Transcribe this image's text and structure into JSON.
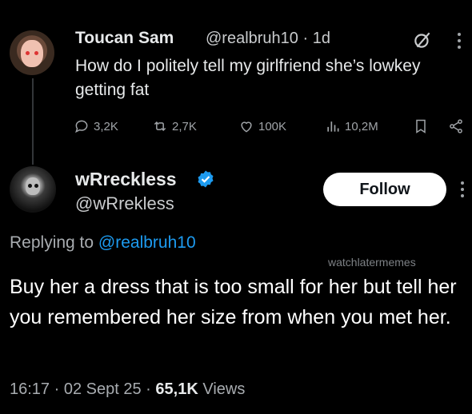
{
  "original_tweet": {
    "display_name": "Toucan Sam",
    "handle": "@realbruh10",
    "separator": "·",
    "age": "1d",
    "text": "How do I politely tell my girlfriend she’s lowkey getting fat",
    "replies": "3,2K",
    "reposts": "2,7K",
    "likes": "100K",
    "views": "10,2M"
  },
  "reply_tweet": {
    "display_name": "wRreckless",
    "handle": "@wRrekless",
    "follow_label": "Follow",
    "replying_prefix": "Replying to",
    "replying_to": "@realbruh10",
    "text": "Buy her a dress that is too small for her but tell her you remembered her size from when you met her.",
    "time": "16:17",
    "date": "02 Sept 25",
    "dot": "·",
    "view_count": "65,1K",
    "views_label": "Views"
  },
  "watermark": "watchlatermemes",
  "colors": {
    "background": "#000000",
    "text": "#e7e9ea",
    "muted": "#a8acb0",
    "accent": "#1d9bf0",
    "verified": "#1d9bf0"
  },
  "icons": [
    "grok-icon",
    "more-icon",
    "reply-icon",
    "repost-icon",
    "like-icon",
    "views-icon",
    "bookmark-icon",
    "share-icon",
    "verified-icon"
  ]
}
